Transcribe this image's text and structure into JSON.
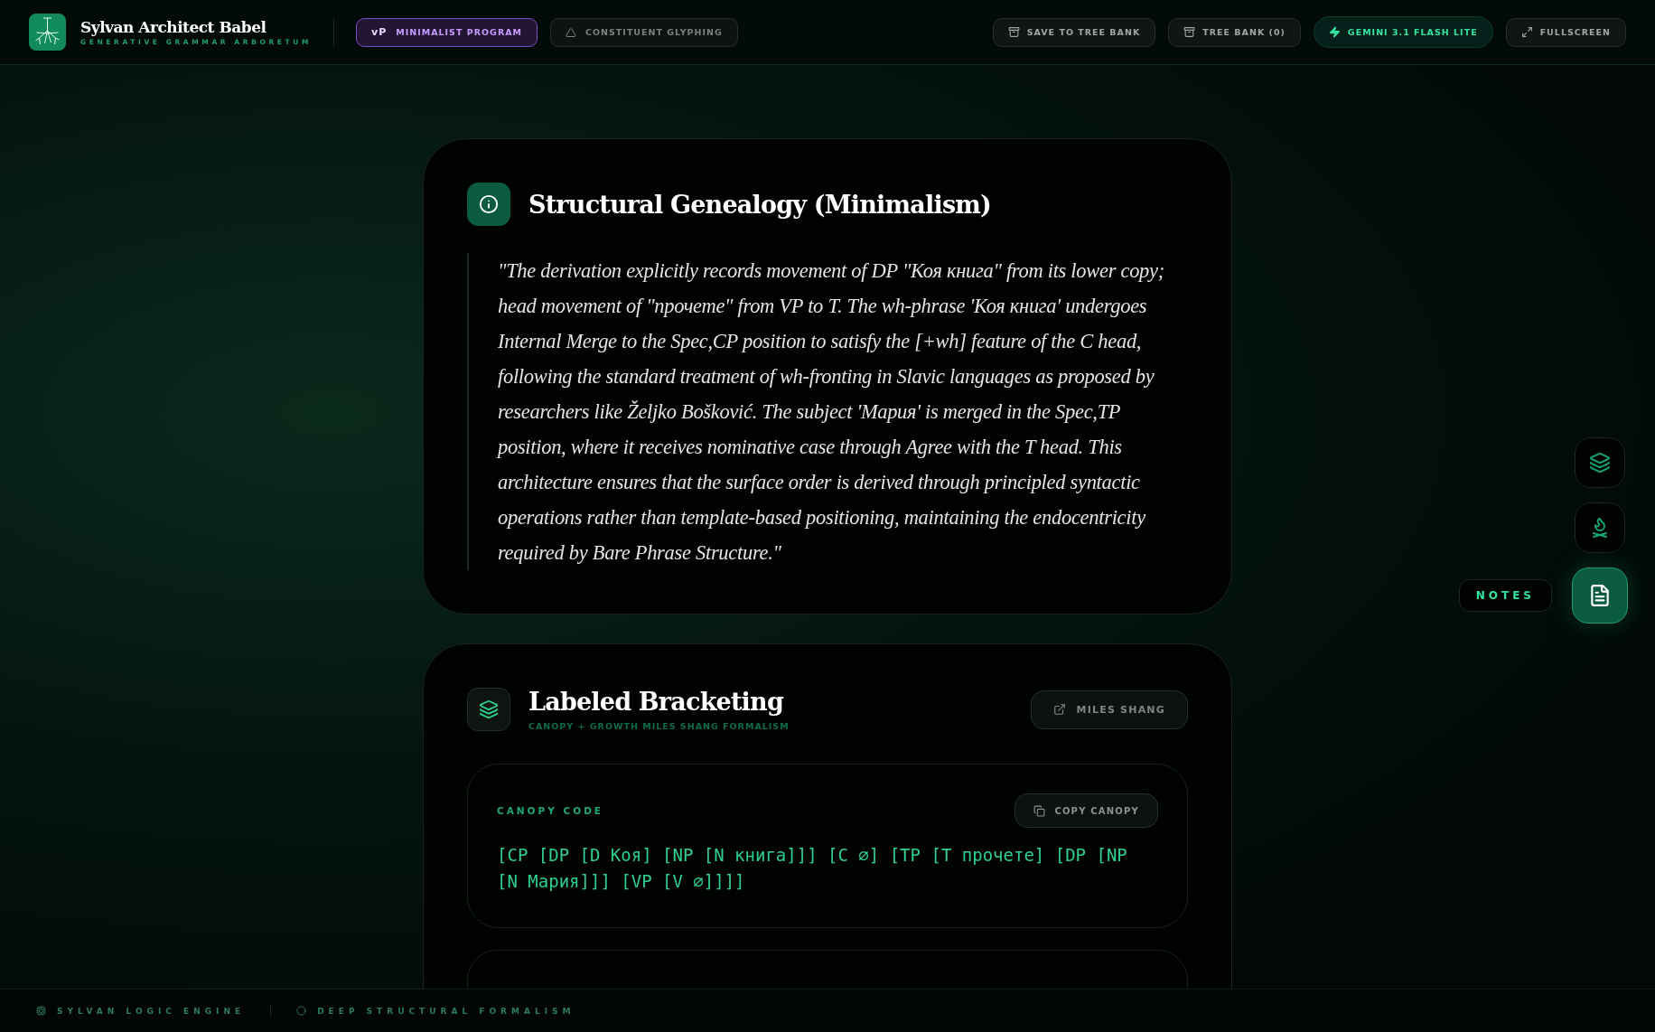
{
  "brand": {
    "title": "Sylvan Architect Babel",
    "subtitle": "GENERATIVE GRAMMAR ARBORETUM"
  },
  "modes": [
    {
      "badge": "vP",
      "label": "MINIMALIST PROGRAM",
      "selected": true
    },
    {
      "label": "CONSTITUENT GLYPHING",
      "selected": false
    }
  ],
  "actions": [
    {
      "kind": "save",
      "label": "SAVE TO TREE BANK"
    },
    {
      "kind": "bank",
      "label": "TREE BANK (0)"
    },
    {
      "kind": "model",
      "label": "GEMINI 3.1 FLASH LITE"
    },
    {
      "kind": "fullscreen",
      "label": "FULLSCREEN"
    }
  ],
  "genealogy": {
    "title": "Structural Genealogy (Minimalism)",
    "quote": "\"The derivation explicitly records movement of DP \"Коя книга\" from its lower copy; head movement of \"прочете\" from VP to T. The wh-phrase 'Коя книга' undergoes Internal Merge to the Spec,CP position to satisfy the [+wh] feature of the C head, following the standard treatment of wh-fronting in Slavic languages as proposed by researchers like Željko Bošković. The subject 'Мария' is merged in the Spec,TP position, where it receives nominative case through Agree with the T head. This architecture ensures that the surface order is derived through principled syntactic operations rather than template-based positioning, maintaining the endocentricity required by Bare Phrase Structure.\""
  },
  "bracketing": {
    "title": "Labeled Bracketing",
    "subtitle": "CANOPY + GROWTH MILES SHANG FORMALISM",
    "link": "MILES SHANG",
    "code_label": "CANOPY CODE",
    "copy": "COPY CANOPY",
    "code": "[CP [DP [D Коя] [NP [N книга]]] [C ∅] [TP [T прочете] [DP [NP [N Мария]]] [VP [V ∅]]]]"
  },
  "dock": [
    {
      "kind": "layers",
      "selected": false
    },
    {
      "kind": "campfire",
      "selected": false
    },
    {
      "kind": "notes",
      "selected": true,
      "tooltip": "NOTES"
    }
  ],
  "footer": [
    "SYLVAN LOGIC ENGINE",
    "DEEP STRUCTURAL FORMALISM"
  ]
}
